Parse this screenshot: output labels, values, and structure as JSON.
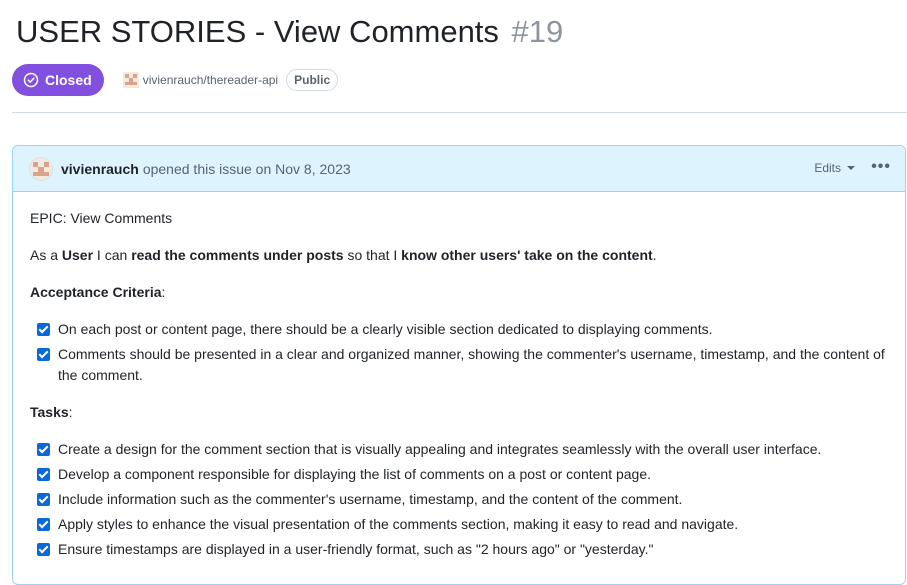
{
  "issue": {
    "title": "USER STORIES - View Comments",
    "number": "#19",
    "state": "Closed",
    "repo": "vivienrauch/thereader-api",
    "visibility": "Public"
  },
  "comment": {
    "author": "vivienrauch",
    "action": "opened this issue on Nov 8, 2023",
    "edits_label": "Edits",
    "more_icon": "kebab-horizontal-icon",
    "epic": "EPIC: View Comments",
    "story": {
      "p1": "As a ",
      "b1": "User",
      "p2": " I can ",
      "b2": "read the comments under posts",
      "p3": " so that I ",
      "b3": "know other users' take on the content",
      "p4": "."
    },
    "acceptance_heading": "Acceptance Criteria",
    "acceptance_colon": ":",
    "acceptance": [
      "On each post or content page, there should be a clearly visible section dedicated to displaying comments.",
      "Comments should be presented in a clear and organized manner, showing the commenter's username, timestamp, and the content of the comment."
    ],
    "tasks_heading": "Tasks",
    "tasks_colon": ":",
    "tasks": [
      "Create a design for the comment section that is visually appealing and integrates seamlessly with the overall user interface.",
      "Develop a component responsible for displaying the list of comments on a post or content page.",
      "Include information such as the commenter's username, timestamp, and the content of the comment.",
      "Apply styles to enhance the visual presentation of the comments section, making it easy to read and navigate.",
      "Ensure timestamps are displayed in a user-friendly format, such as \"2 hours ago\" or \"yesterday.\""
    ]
  },
  "colors": {
    "closed_badge": "#8250df",
    "header_bg": "#ddf4ff",
    "header_border": "#9cd3f5",
    "checkbox": "#0969da"
  }
}
